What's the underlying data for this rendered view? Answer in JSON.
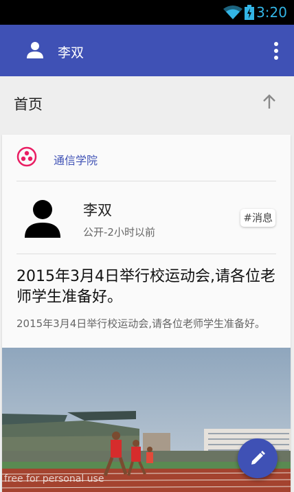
{
  "status_bar": {
    "time": "3:20"
  },
  "app_bar": {
    "title": "李双",
    "user_icon": "person-icon",
    "menu_icon": "more-vert-icon"
  },
  "section": {
    "label": "首页",
    "icon": "arrow-up-icon"
  },
  "card": {
    "org_name": "通信学院",
    "org_icon": "circles-icon",
    "author": "李双",
    "meta": "公开-2小时以前",
    "tag": "#消息",
    "title": "2015年3月4日举行校运动会,请各位老师学生准备好。",
    "body": "2015年3月4日举行校运动会,请各位老师学生准备好。"
  },
  "fab": {
    "icon": "pencil-icon"
  },
  "watermark": "free for personal use",
  "colors": {
    "primary": "#3f51b5",
    "accent": "#e91e63",
    "status_icon": "#33b5e5"
  }
}
